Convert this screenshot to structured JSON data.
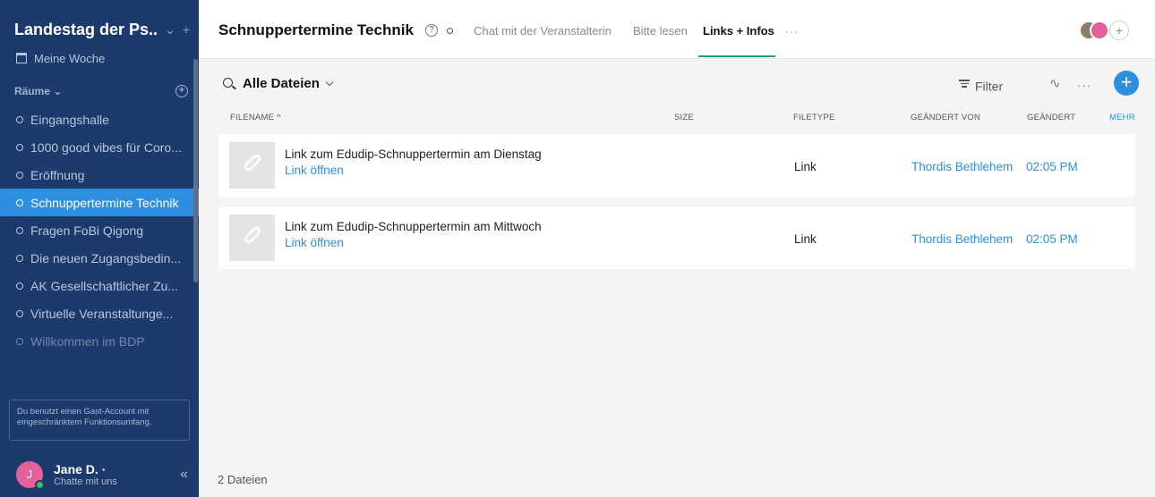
{
  "sidebar": {
    "org_name": "Landestag der Ps...",
    "my_week": "Meine Woche",
    "rooms_label": "Räume",
    "items": [
      {
        "label": "Eingangshalle"
      },
      {
        "label": "1000 good vibes für Coro..."
      },
      {
        "label": "Eröffnung"
      },
      {
        "label": "Schnuppertermine Technik"
      },
      {
        "label": "Fragen FoBi Qigong"
      },
      {
        "label": "Die neuen Zugangsbedin..."
      },
      {
        "label": "AK Gesellschaftlicher Zu..."
      },
      {
        "label": "Virtuelle Veranstaltunge..."
      },
      {
        "label": "Willkommen im BDP"
      }
    ],
    "active_index": 3,
    "guest_notice": "Du benutzt einen Gast-Account mit eingeschränktem Funktionsumfang.",
    "user": {
      "initial": "J",
      "name": "Jane D. ·",
      "status": "Chatte mit uns"
    }
  },
  "header": {
    "title": "Schnuppertermine Technik",
    "tabs": [
      {
        "label": "Chat mit der Veranstalterin"
      },
      {
        "label": "Bitte lesen"
      },
      {
        "label": "Links + Infos"
      }
    ],
    "active_tab": 2,
    "more": "···",
    "avatar_plus": "+"
  },
  "toolbar": {
    "title": "Alle Dateien",
    "filter_label": "Filter",
    "more": "···",
    "add": "+"
  },
  "table": {
    "headers": {
      "filename": "FILENAME ^",
      "size": "SIZE",
      "filetype": "FILETYPE",
      "changed_by": "GEÄNDERT VON",
      "changed": "GEÄNDERT",
      "more": "MEHR"
    },
    "rows": [
      {
        "name": "Link zum Edudip-Schnuppertermin am Dienstag",
        "action": "Link öffnen",
        "type": "Link",
        "user": "Thordis Bethlehem",
        "time": "02:05 PM"
      },
      {
        "name": "Link zum Edudip-Schnuppertermin am Mittwoch",
        "action": "Link öffnen",
        "type": "Link",
        "user": "Thordis Bethlehem",
        "time": "02:05 PM"
      }
    ]
  },
  "footer": {
    "count": "2 Dateien"
  },
  "colors": {
    "sidebar": "#1c3a6b",
    "accent": "#2d8fe0",
    "tab_underline": "#1a9f77",
    "user_avatar": "#e4609a"
  }
}
